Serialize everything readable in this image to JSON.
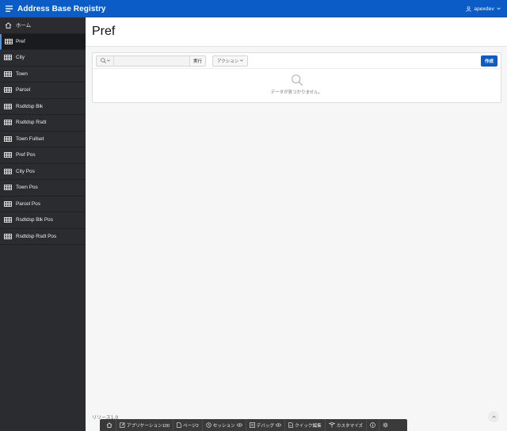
{
  "header": {
    "app_title": "Address Base Registry",
    "user": "apexdev"
  },
  "sidebar": {
    "items": [
      {
        "label": "ホーム",
        "icon": "home-icon"
      },
      {
        "label": "Pref",
        "icon": "table-icon",
        "active": true
      },
      {
        "label": "City",
        "icon": "table-icon"
      },
      {
        "label": "Town",
        "icon": "table-icon"
      },
      {
        "label": "Parcel",
        "icon": "table-icon"
      },
      {
        "label": "Rsdtdsp Blk",
        "icon": "table-icon"
      },
      {
        "label": "Rsdtdsp Rsdt",
        "icon": "table-icon"
      },
      {
        "label": "Town Fullset",
        "icon": "table-icon"
      },
      {
        "label": "Pref Pos",
        "icon": "table-icon"
      },
      {
        "label": "City Pos",
        "icon": "table-icon"
      },
      {
        "label": "Town Pos",
        "icon": "table-icon"
      },
      {
        "label": "Parcel Pos",
        "icon": "table-icon"
      },
      {
        "label": "Rsdtdsp Blk Pos",
        "icon": "table-icon"
      },
      {
        "label": "Rsdtdsp Rsdt Pos",
        "icon": "table-icon"
      }
    ]
  },
  "main": {
    "page_title": "Pref",
    "search": {
      "placeholder": "",
      "value": "",
      "go_label": "実行"
    },
    "actions_label": "アクション",
    "create_label": "作成",
    "no_data_text": "データが見つかりません。",
    "release": "リリース1.0"
  },
  "devbar": {
    "items": [
      {
        "label": "",
        "icon": "home-icon"
      },
      {
        "label": "アプリケーション100",
        "icon": "edit-icon"
      },
      {
        "label": "ページ2",
        "icon": "page-edit-icon"
      },
      {
        "label": "セッション",
        "icon": "session-icon"
      },
      {
        "label": "デバッグ",
        "icon": "debug-icon"
      },
      {
        "label": "クイック編集",
        "icon": "quick-edit-icon"
      },
      {
        "label": "カスタマイズ",
        "icon": "customize-icon"
      },
      {
        "label": "",
        "icon": "info-icon"
      },
      {
        "label": "",
        "icon": "gear-icon"
      }
    ]
  },
  "colors": {
    "header_bg": "#0b5cc6",
    "sidebar_bg": "#2a2c2f",
    "accent": "#0b5cc6",
    "devbar_bg": "#3a3a3a"
  }
}
